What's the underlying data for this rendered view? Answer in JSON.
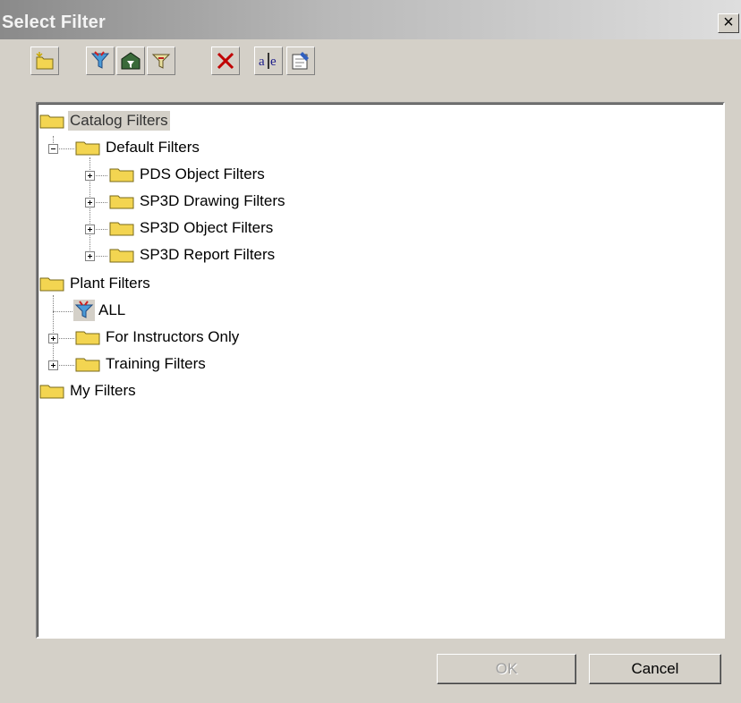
{
  "window": {
    "title": "Select Filter",
    "close_label": "×"
  },
  "toolbar": {
    "buttons": [
      {
        "icon": "new-folder-icon",
        "tooltip": ""
      },
      {
        "icon": "new-filter-icon",
        "tooltip": ""
      },
      {
        "icon": "new-asking-filter-icon",
        "tooltip": ""
      },
      {
        "icon": "new-compound-filter-icon",
        "tooltip": ""
      },
      {
        "icon": "delete-icon",
        "tooltip": ""
      },
      {
        "icon": "rename-icon",
        "tooltip": ""
      },
      {
        "icon": "properties-icon",
        "tooltip": ""
      }
    ]
  },
  "tree": {
    "catalog": "Catalog Filters",
    "default": "Default Filters",
    "pds_object": "PDS Object Filters",
    "sp3d_drawing": "SP3D Drawing Filters",
    "sp3d_object": "SP3D Object Filters",
    "sp3d_report": "SP3D Report Filters",
    "plant": "Plant Filters",
    "all": "ALL",
    "instructors": "For Instructors Only",
    "training": "Training Filters",
    "my": "My Filters"
  },
  "buttons": {
    "ok": "OK",
    "cancel": "Cancel"
  },
  "colors": {
    "folder": "#f3d551",
    "folder_edge": "#7a6a1a",
    "delete": "#c00000"
  }
}
